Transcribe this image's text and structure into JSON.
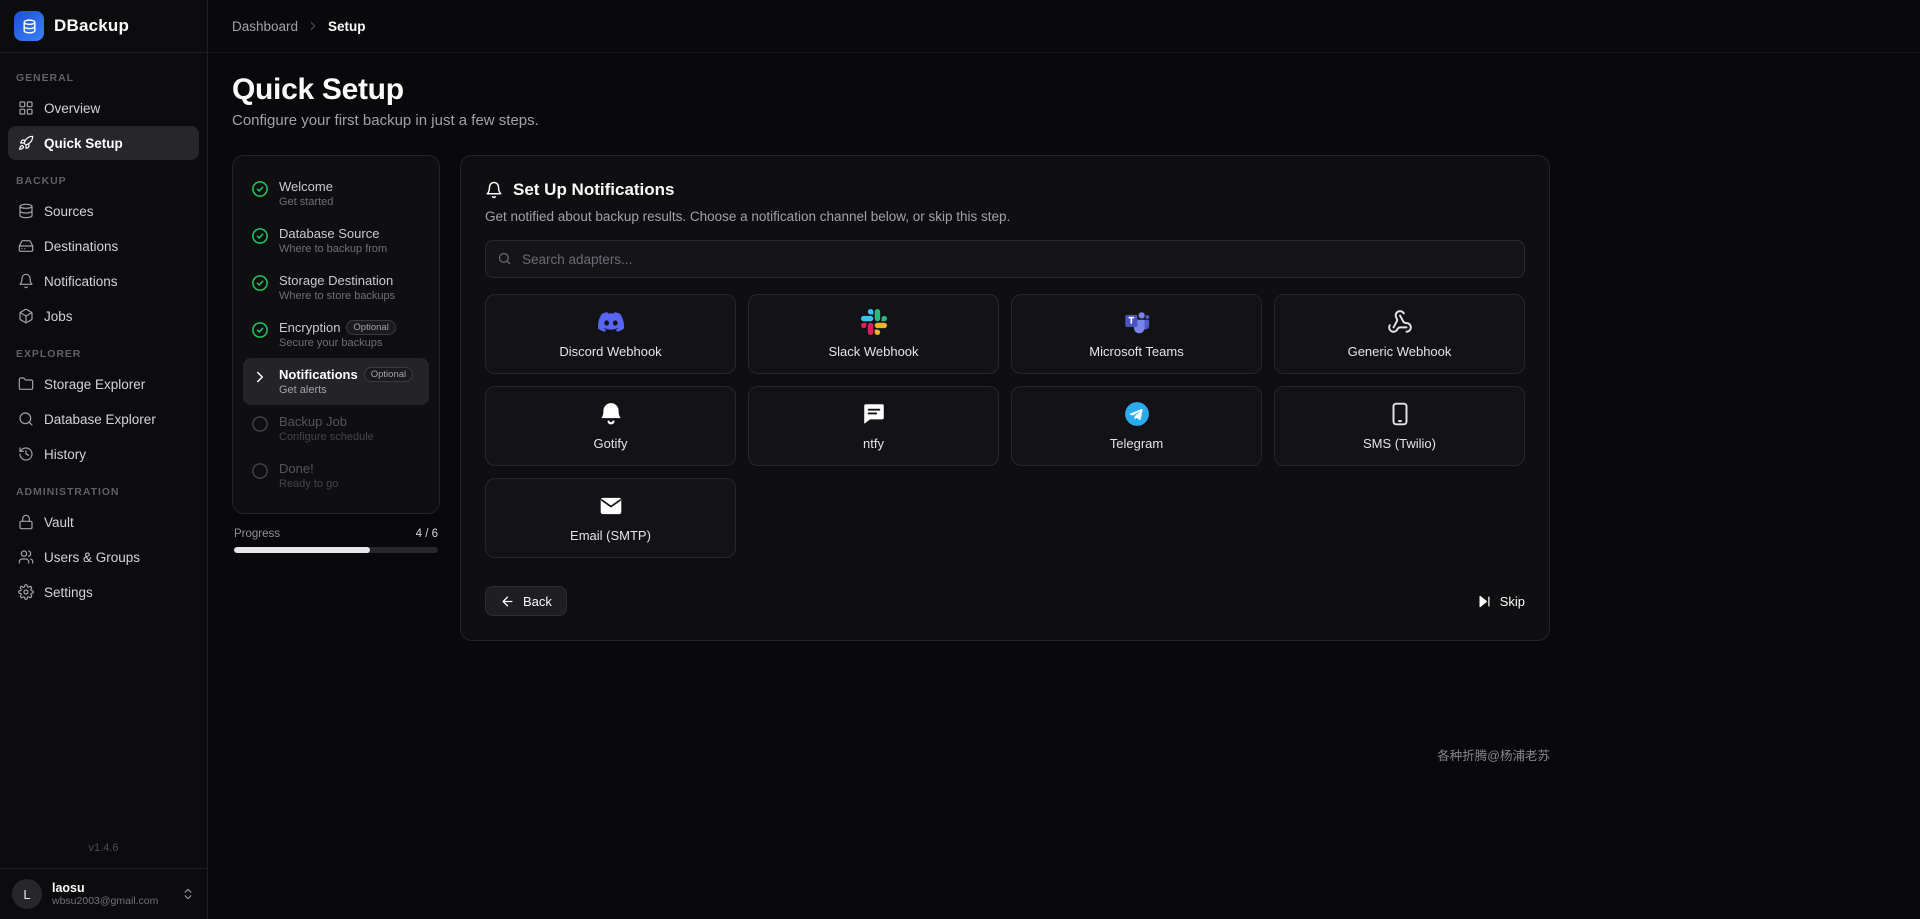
{
  "colors": {
    "accent_blue": "#3b82f6",
    "success_green": "#22c55e",
    "discord_blurple": "#5865F2",
    "slack_palette": [
      "#36C5F0",
      "#2EB67D",
      "#ECB22E",
      "#E01E5A"
    ],
    "teams_purple": "#4B53BC",
    "telegram_blue": "#2AABEE"
  },
  "app": {
    "name": "DBackup",
    "version": "v1.4.6"
  },
  "breadcrumb": {
    "root": "Dashboard",
    "current": "Setup"
  },
  "sidebar": {
    "sections": [
      {
        "label": "GENERAL",
        "items": [
          {
            "label": "Overview",
            "icon": "grid-icon"
          },
          {
            "label": "Quick Setup",
            "icon": "rocket-icon",
            "active": true
          }
        ]
      },
      {
        "label": "BACKUP",
        "items": [
          {
            "label": "Sources",
            "icon": "database-icon"
          },
          {
            "label": "Destinations",
            "icon": "hard-drive-icon"
          },
          {
            "label": "Notifications",
            "icon": "bell-icon"
          },
          {
            "label": "Jobs",
            "icon": "package-icon"
          }
        ]
      },
      {
        "label": "EXPLORER",
        "items": [
          {
            "label": "Storage Explorer",
            "icon": "folder-icon"
          },
          {
            "label": "Database Explorer",
            "icon": "search-icon"
          },
          {
            "label": "History",
            "icon": "history-icon"
          }
        ]
      },
      {
        "label": "ADMINISTRATION",
        "items": [
          {
            "label": "Vault",
            "icon": "lock-icon"
          },
          {
            "label": "Users & Groups",
            "icon": "users-icon"
          },
          {
            "label": "Settings",
            "icon": "gear-icon"
          }
        ]
      }
    ]
  },
  "user": {
    "initial": "L",
    "name": "laosu",
    "email": "wbsu2003@gmail.com"
  },
  "page": {
    "title": "Quick Setup",
    "subtitle": "Configure your first backup in just a few steps."
  },
  "steps": {
    "items": [
      {
        "title": "Welcome",
        "subtitle": "Get started",
        "state": "done"
      },
      {
        "title": "Database Source",
        "subtitle": "Where to backup from",
        "state": "done"
      },
      {
        "title": "Storage Destination",
        "subtitle": "Where to store backups",
        "state": "done"
      },
      {
        "title": "Encryption",
        "badge": "Optional",
        "subtitle": "Secure your backups",
        "state": "done"
      },
      {
        "title": "Notifications",
        "badge": "Optional",
        "subtitle": "Get alerts",
        "state": "active"
      },
      {
        "title": "Backup Job",
        "subtitle": "Configure schedule",
        "state": "pending"
      },
      {
        "title": "Done!",
        "subtitle": "Ready to go",
        "state": "pending"
      }
    ],
    "progress": {
      "label": "Progress",
      "value": "4 / 6",
      "percent": 66.7
    }
  },
  "panel": {
    "title": "Set Up Notifications",
    "subtitle": "Get notified about backup results. Choose a notification channel below, or skip this step.",
    "search": {
      "placeholder": "Search adapters..."
    },
    "adapters": [
      {
        "label": "Discord Webhook",
        "icon": "discord-icon"
      },
      {
        "label": "Slack Webhook",
        "icon": "slack-icon"
      },
      {
        "label": "Microsoft Teams",
        "icon": "teams-icon"
      },
      {
        "label": "Generic Webhook",
        "icon": "webhook-icon"
      },
      {
        "label": "Gotify",
        "icon": "gotify-bell-icon"
      },
      {
        "label": "ntfy",
        "icon": "chat-bubble-icon"
      },
      {
        "label": "Telegram",
        "icon": "telegram-icon"
      },
      {
        "label": "SMS (Twilio)",
        "icon": "smartphone-icon"
      },
      {
        "label": "Email (SMTP)",
        "icon": "envelope-icon"
      }
    ],
    "back_label": "Back",
    "skip_label": "Skip"
  },
  "watermark": "各种折腾@杨浦老苏"
}
